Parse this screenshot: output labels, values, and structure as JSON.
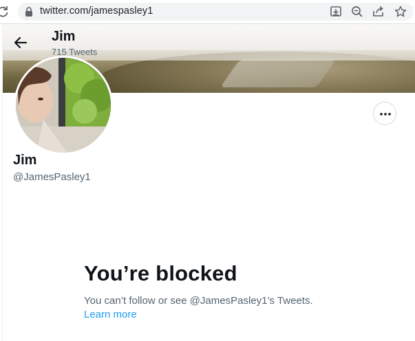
{
  "browser": {
    "url": "twitter.com/jamespasley1",
    "toolbar_icons": [
      "install-icon",
      "zoom-out-icon",
      "share-icon",
      "bookmark-star-icon"
    ]
  },
  "header": {
    "name": "Jim",
    "tweet_count": "715 Tweets"
  },
  "profile": {
    "name": "Jim",
    "handle": "@JamesPasley1"
  },
  "blocked": {
    "title": "You’re blocked",
    "description": "You can’t follow or see @JamesPasley1’s Tweets.",
    "learn_more": "Learn more"
  },
  "colors": {
    "link": "#1d9bf0",
    "secondary_text": "#536471",
    "primary_text": "#0f1419"
  }
}
